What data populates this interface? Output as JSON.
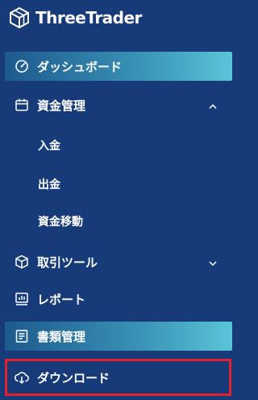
{
  "brand": {
    "name": "ThreeTrader"
  },
  "menu": {
    "dashboard": {
      "label": "ダッシュボード",
      "icon": "gauge-icon"
    },
    "funds": {
      "label": "資金管理",
      "icon": "calendar-icon",
      "expanded": true,
      "children": [
        {
          "label": "入金"
        },
        {
          "label": "出金"
        },
        {
          "label": "資金移動"
        }
      ]
    },
    "trading_tools": {
      "label": "取引ツール",
      "icon": "cube-icon",
      "expanded": false
    },
    "reports": {
      "label": "レポート",
      "icon": "chart-report-icon"
    },
    "documents": {
      "label": "書類管理",
      "icon": "document-icon"
    },
    "download": {
      "label": "ダウンロード",
      "icon": "download-icon"
    }
  },
  "colors": {
    "background": "#163b78",
    "active_gradient_start": "#1d5a8e",
    "active_gradient_end": "#5ac4d6",
    "highlight_border": "#e3202c"
  }
}
